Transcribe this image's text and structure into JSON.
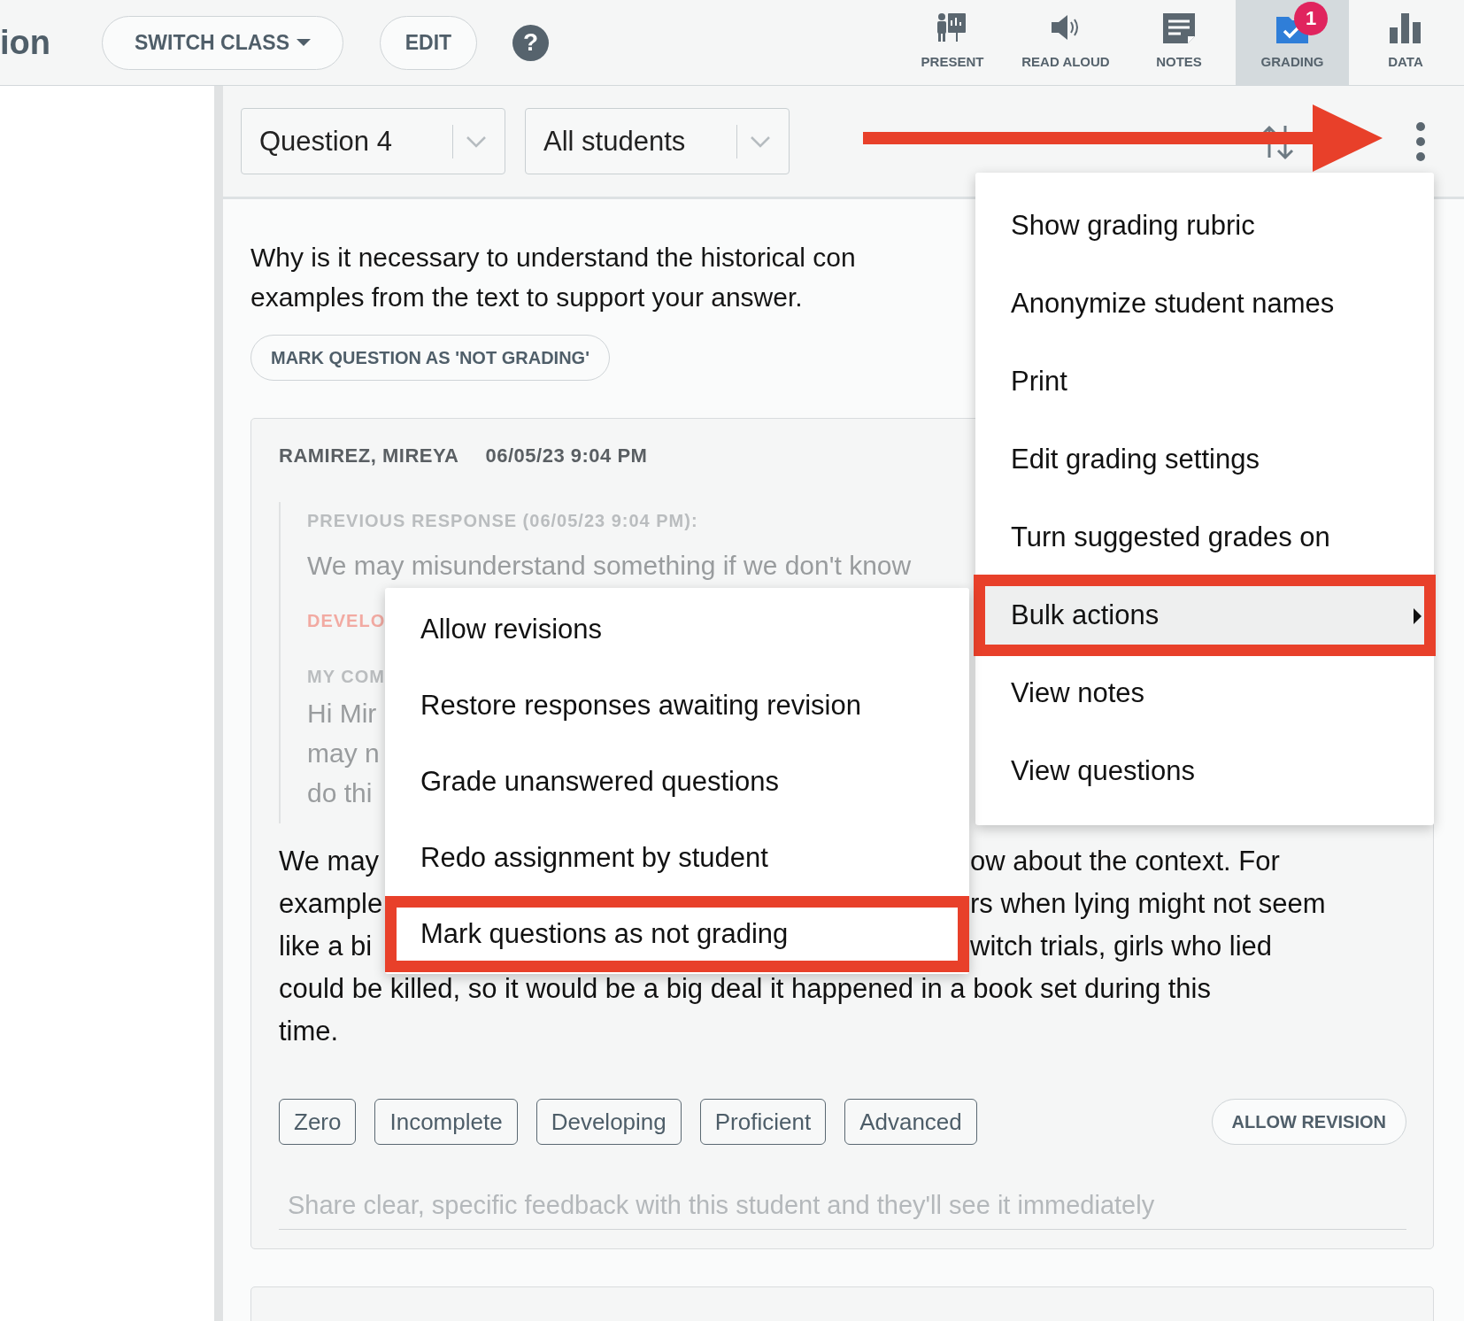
{
  "header": {
    "title": "ion",
    "switch_class": "SWITCH CLASS",
    "edit": "EDIT",
    "help": "?"
  },
  "toolbar": [
    {
      "label": "PRESENT",
      "kind": "present",
      "selected": false
    },
    {
      "label": "READ ALOUD",
      "kind": "speaker",
      "selected": false
    },
    {
      "label": "NOTES",
      "kind": "notes",
      "selected": false
    },
    {
      "label": "GRADING",
      "kind": "grading",
      "selected": true,
      "badge": "1"
    },
    {
      "label": "DATA",
      "kind": "data",
      "selected": false
    }
  ],
  "filters": [
    {
      "value": "Question 4"
    },
    {
      "value": "All students"
    }
  ],
  "question": {
    "lines": [
      "Why is it necessary to understand the historical con",
      "examples from the text to support your answer."
    ],
    "mark_button": "MARK QUESTION AS 'NOT GRADING'"
  },
  "response": {
    "student": "RAMIREZ, MIREYA",
    "timestamp": "06/05/23 9:04 PM",
    "previous": {
      "label": "PREVIOUS RESPONSE (06/05/23 9:04 PM):",
      "text": "We may misunderstand something if we don't know",
      "grade": "DEVELO",
      "comment_label": "MY COM",
      "comment_lines": [
        "Hi Mir",
        "may n",
        "do thi"
      ]
    },
    "answer_lines": [
      {
        "left": "We may",
        "right": "ow about the context. For"
      },
      {
        "left": "example",
        "right": "rs when lying might not seem"
      },
      {
        "left": "like a bi",
        "right": "witch trials, girls who lied"
      },
      {
        "left": "could be killed, so it would be a big deal it happened in a book set during this"
      },
      {
        "left": "time."
      }
    ],
    "grades": [
      "Zero",
      "Incomplete",
      "Developing",
      "Proficient",
      "Advanced"
    ],
    "allow_revision": "ALLOW REVISION",
    "feedback_placeholder": "Share clear, specific feedback with this student and they'll see it immediately"
  },
  "menu": {
    "items": [
      {
        "label": "Show grading rubric",
        "selected": false,
        "submenu": false,
        "callout": false
      },
      {
        "label": "Anonymize student names",
        "selected": false,
        "submenu": false,
        "callout": false
      },
      {
        "label": "Print",
        "selected": false,
        "submenu": false,
        "callout": false
      },
      {
        "label": "Edit grading settings",
        "selected": false,
        "submenu": false,
        "callout": false
      },
      {
        "label": "Turn suggested grades on",
        "selected": false,
        "submenu": false,
        "callout": false
      },
      {
        "label": "Bulk actions",
        "selected": true,
        "submenu": true,
        "callout": true
      },
      {
        "label": "View notes",
        "selected": false,
        "submenu": false,
        "callout": false
      },
      {
        "label": "View questions",
        "selected": false,
        "submenu": false,
        "callout": false
      }
    ]
  },
  "submenu": {
    "items": [
      {
        "label": "Allow revisions",
        "callout": false
      },
      {
        "label": "Restore responses awaiting revision",
        "callout": false
      },
      {
        "label": "Grade unanswered questions",
        "callout": false
      },
      {
        "label": "Redo assignment by student",
        "callout": false
      },
      {
        "label": "Mark questions as not grading",
        "callout": true
      }
    ]
  }
}
